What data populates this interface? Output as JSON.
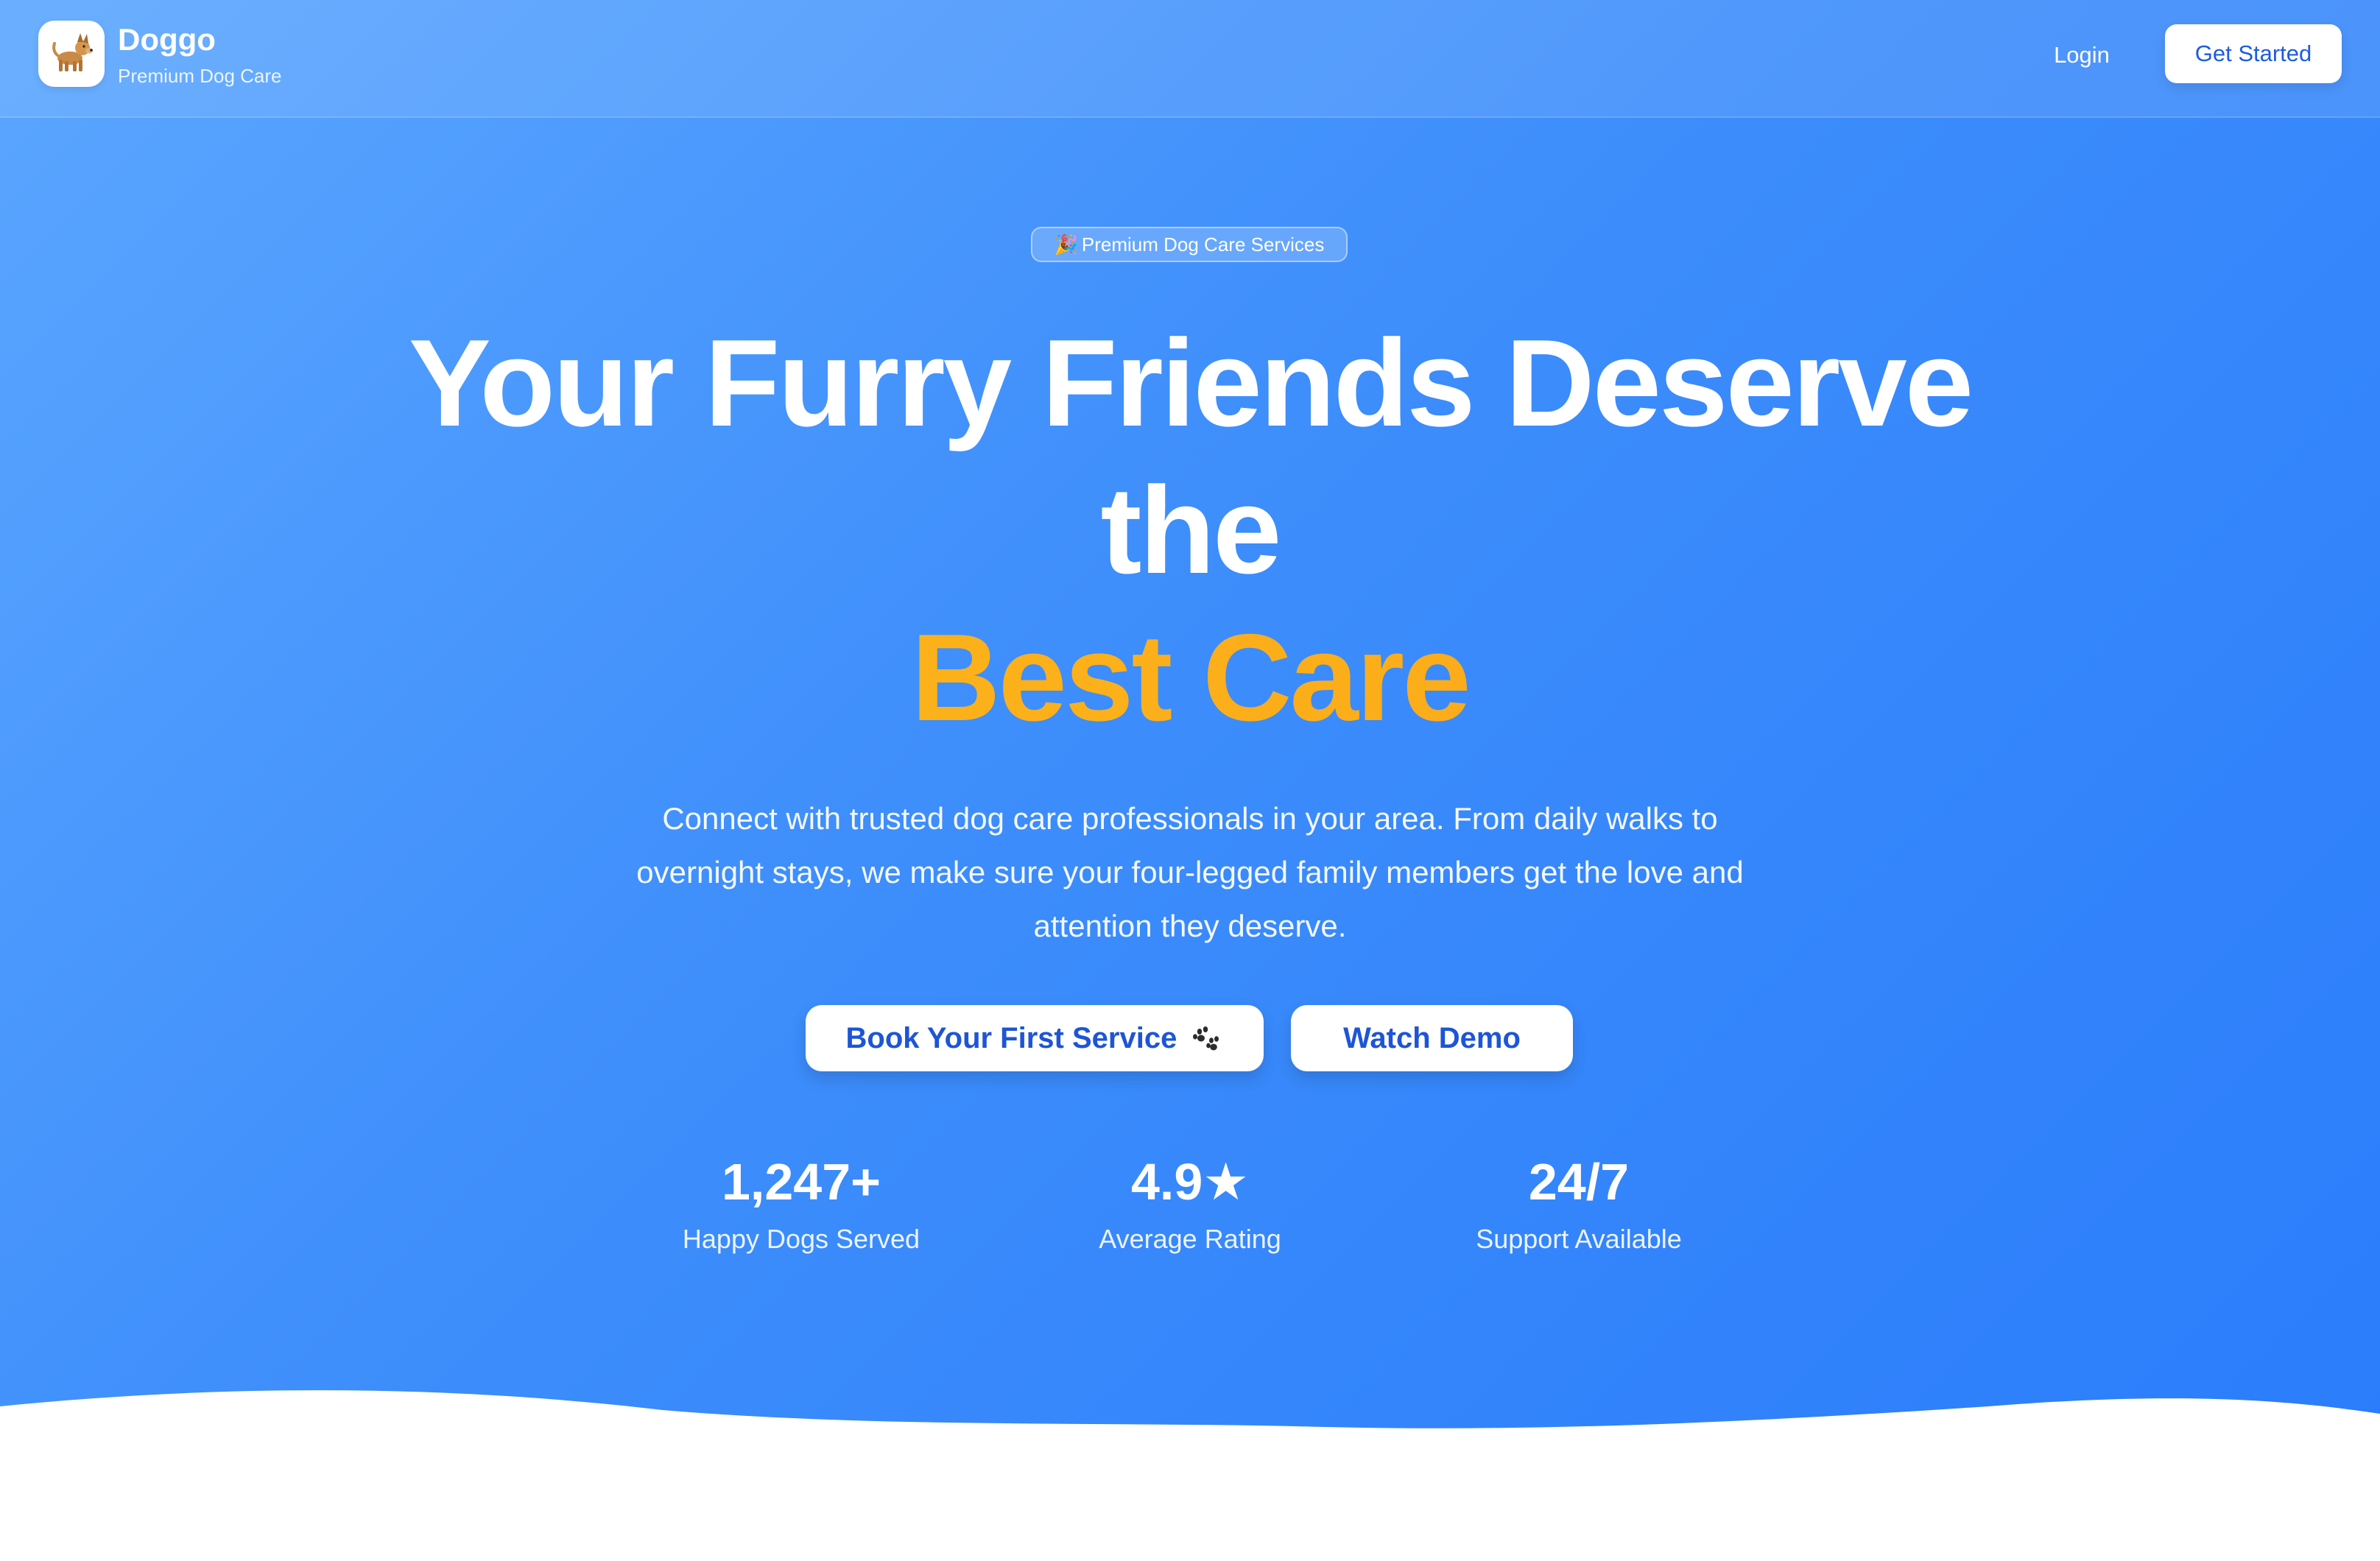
{
  "nav": {
    "brand_name": "Doggo",
    "brand_tagline": "Premium Dog Care",
    "logo_icon": "dog-icon",
    "login_label": "Login",
    "get_started_label": "Get Started"
  },
  "hero": {
    "badge_icon": "party-popper-icon",
    "badge_label": "Premium Dog Care Services",
    "headline_line1": "Your Furry Friends Deserve",
    "headline_line2": "the",
    "headline_accent": "Best Care",
    "subtext": "Connect with trusted dog care professionals in your area. From daily walks to overnight stays, we make sure your four-legged family members get the love and attention they deserve.",
    "primary_button_label": "Book Your First Service",
    "primary_button_icon": "paw-prints-icon",
    "secondary_button_label": "Watch Demo"
  },
  "stats": [
    {
      "value": "1,247+",
      "label": "Happy Dogs Served"
    },
    {
      "value": "4.9★",
      "label": "Average Rating"
    },
    {
      "value": "24/7",
      "label": "Support Available"
    }
  ],
  "colors": {
    "gradient_start": "#5aa6ff",
    "gradient_end": "#2a7cfb",
    "accent": "#fbb118",
    "button_text": "#1d55d6",
    "white": "#ffffff"
  }
}
